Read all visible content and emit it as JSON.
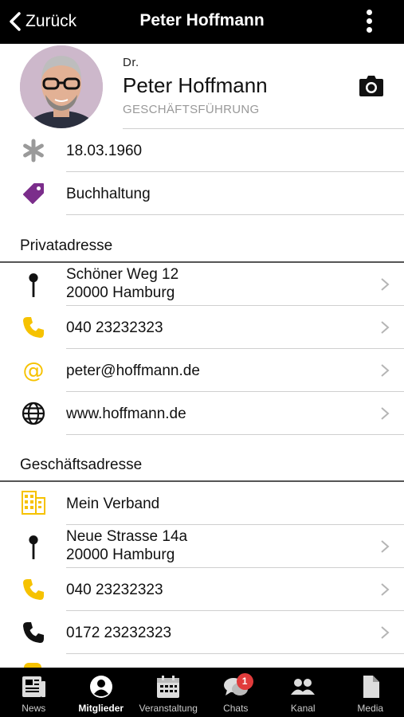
{
  "header": {
    "back_label": "Zurück",
    "title": "Peter Hoffmann",
    "menu_icon": "more-vertical-icon"
  },
  "profile": {
    "prefix": "Dr.",
    "name": "Peter Hoffmann",
    "role": "GESCHÄFTSFÜHRUNG",
    "camera_icon": "camera-icon"
  },
  "info_rows": [
    {
      "icon": "asterisk-icon",
      "text": "18.03.1960",
      "color": "#9a9a9a"
    },
    {
      "icon": "tag-icon",
      "text": "Buchhaltung",
      "color": "#7b2d8b"
    }
  ],
  "private": {
    "title": "Privatadresse",
    "address_line1": "Schöner Weg 12",
    "address_line2": "20000 Hamburg",
    "phone": "040 23232323",
    "email": "peter@hoffmann.de",
    "website": "www.hoffmann.de"
  },
  "business": {
    "title": "Geschäftsadresse",
    "organisation": "Mein Verband",
    "address_line1": "Neue Strasse 14a",
    "address_line2": "20000 Hamburg",
    "phone": "040 23232323",
    "mobile": "0172 23232323"
  },
  "colors": {
    "accent": "#f6c200",
    "header_bg": "#000000",
    "badge": "#e03b3b"
  },
  "tabs": [
    {
      "label": "News",
      "icon": "newspaper-icon",
      "active": false
    },
    {
      "label": "Mitglieder",
      "icon": "user-circle-icon",
      "active": true
    },
    {
      "label": "Veranstaltung",
      "icon": "calendar-icon",
      "active": false
    },
    {
      "label": "Chats",
      "icon": "chat-bubbles-icon",
      "active": false,
      "badge": "1"
    },
    {
      "label": "Kanal",
      "icon": "group-icon",
      "active": false
    },
    {
      "label": "Media",
      "icon": "document-icon",
      "active": false
    }
  ]
}
